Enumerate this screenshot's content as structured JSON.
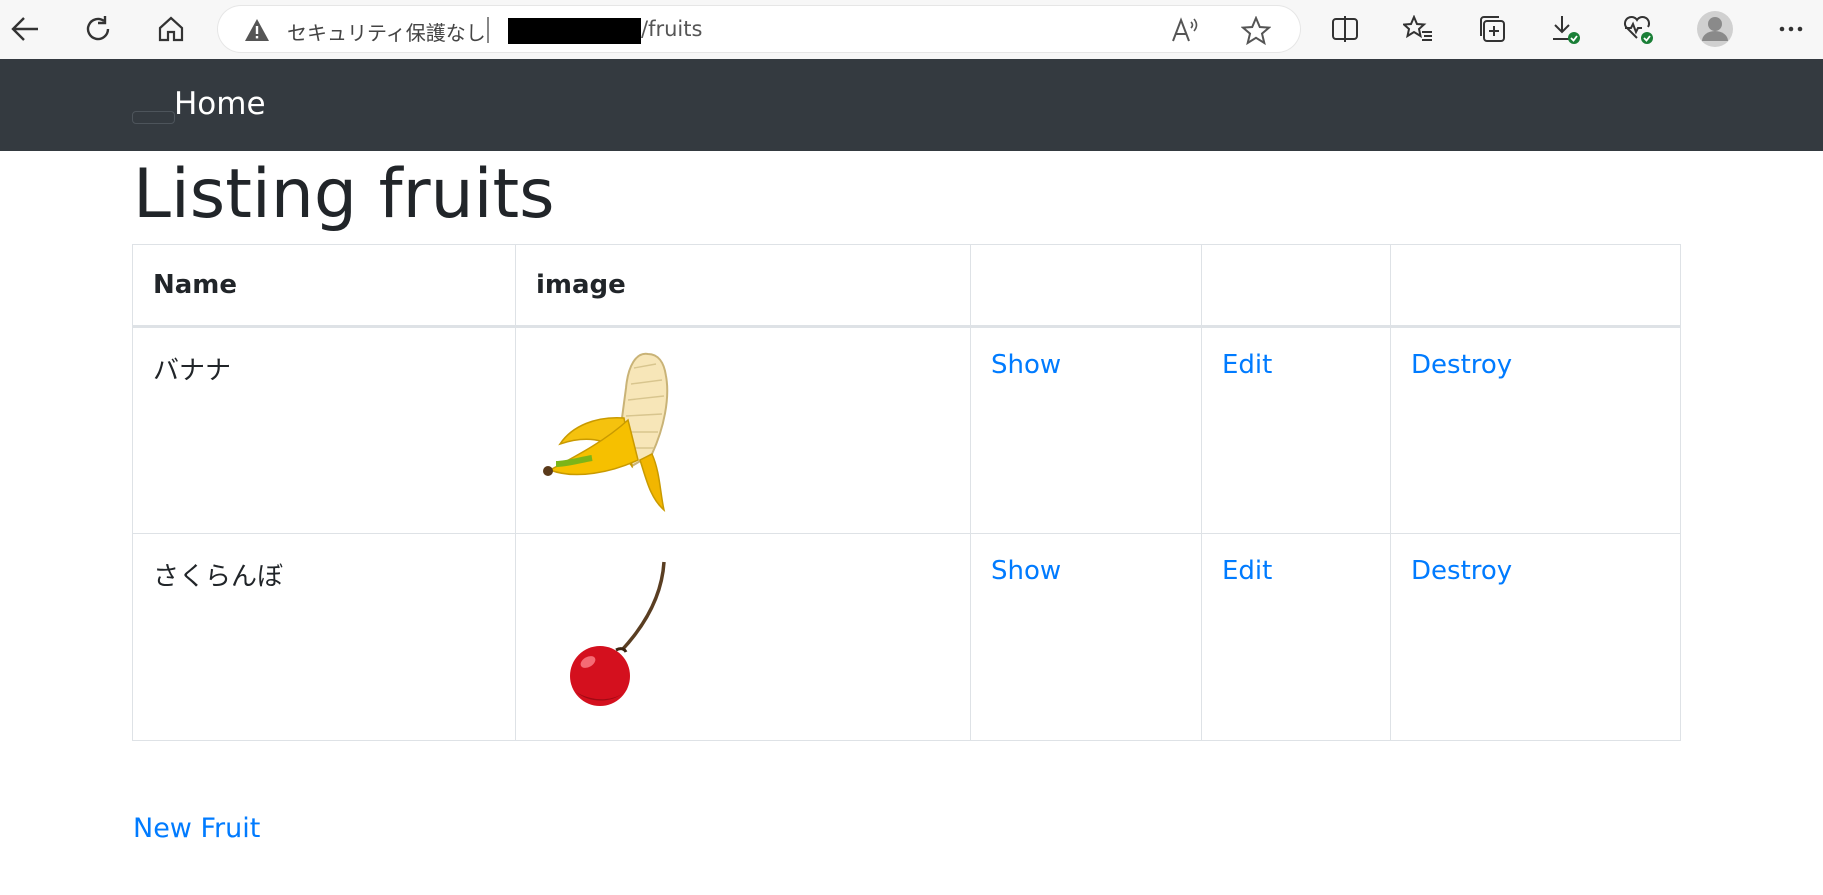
{
  "browser": {
    "security_text": "セキュリティ保護なし",
    "url_path": "/fruits"
  },
  "navbar": {
    "home": "Home"
  },
  "page": {
    "title": "Listing fruits"
  },
  "table": {
    "headers": [
      "Name",
      "image",
      "",
      "",
      ""
    ],
    "rows": [
      {
        "name": "バナナ",
        "image_icon": "banana-image",
        "show": "Show",
        "edit": "Edit",
        "destroy": "Destroy"
      },
      {
        "name": "さくらんぼ",
        "image_icon": "cherry-image",
        "show": "Show",
        "edit": "Edit",
        "destroy": "Destroy"
      }
    ]
  },
  "new_link": "New Fruit",
  "colors": {
    "navbar": "#343a40",
    "link": "#007bff",
    "text": "#212529"
  }
}
